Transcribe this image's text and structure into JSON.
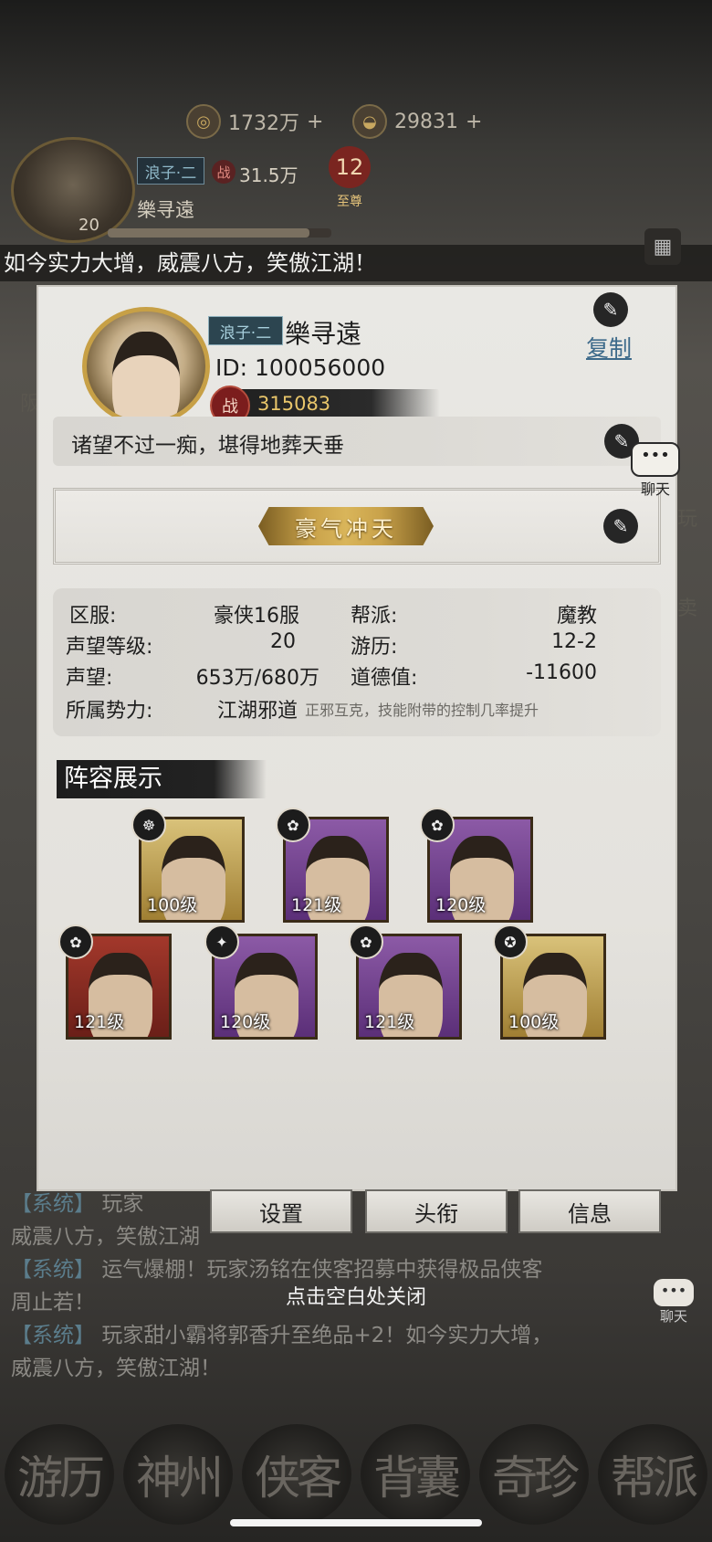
{
  "topbar": {
    "coins": "1732万",
    "ingots": "29831"
  },
  "player": {
    "title_tag": "浪子·二",
    "power": "31.5万",
    "name": "樂寻遠",
    "level": "20",
    "vip_level": "12",
    "vip_label": "至尊",
    "xp_fraction": 0.9
  },
  "marquee": "如今实力大增，威震八方，笑傲江湖！",
  "profile": {
    "title_tag": "浪子·二",
    "name": "樂寻遠",
    "id": "ID: 100056000",
    "power": "315083",
    "copy_label": "复制",
    "motto": "诸望不过一痴，堪得地葬天垂",
    "honor_title": "豪气冲天",
    "info": {
      "server_label": "区服:",
      "server": "豪侠16服",
      "guild_label": "帮派:",
      "guild": "魔教",
      "rep_level_label": "声望等级:",
      "rep_level": "20",
      "travel_label": "游历:",
      "travel": "12-2",
      "rep_label": "声望:",
      "rep": "653万/680万",
      "morality_label": "道德值:",
      "morality": "-11600",
      "faction_label": "所属势力:",
      "faction": "江湖邪道",
      "faction_desc": "正邪互克，技能附带的控制几率提升"
    },
    "lineup_title": "阵容展示",
    "heroes": [
      {
        "level": "100级",
        "rarity": "gold",
        "badge": "☸"
      },
      {
        "level": "121级",
        "rarity": "purple",
        "badge": "✿"
      },
      {
        "level": "120级",
        "rarity": "purple",
        "badge": "✿"
      },
      {
        "level": "121级",
        "rarity": "red",
        "badge": "✿"
      },
      {
        "level": "120级",
        "rarity": "purple",
        "badge": "✦"
      },
      {
        "level": "121级",
        "rarity": "purple",
        "badge": "✿"
      },
      {
        "level": "100级",
        "rarity": "gold",
        "badge": "✪"
      }
    ]
  },
  "tabs": {
    "settings": "设置",
    "title": "头衔",
    "info": "信息"
  },
  "close_hint": "点击空白处关闭",
  "chat_float_label": "聊天",
  "chat_float_icon": "•••",
  "chat_log": [
    {
      "tag": "【系统】",
      "text": "玩家"
    },
    {
      "tag": "",
      "text": "威震八方，笑傲江湖"
    },
    {
      "tag": "【系统】",
      "text": "运气爆棚！玩家汤铭在侠客招募中获得极品侠客"
    },
    {
      "tag": "",
      "text": "周止若！"
    },
    {
      "tag": "【系统】",
      "text": "玩家甜小霸将郭香升至绝品+2！如今实力大增，"
    },
    {
      "tag": "",
      "text": "威震八方，笑傲江湖！"
    }
  ],
  "bottom_nav": [
    "游历",
    "神州",
    "侠客",
    "背囊",
    "奇珍",
    "帮派"
  ]
}
